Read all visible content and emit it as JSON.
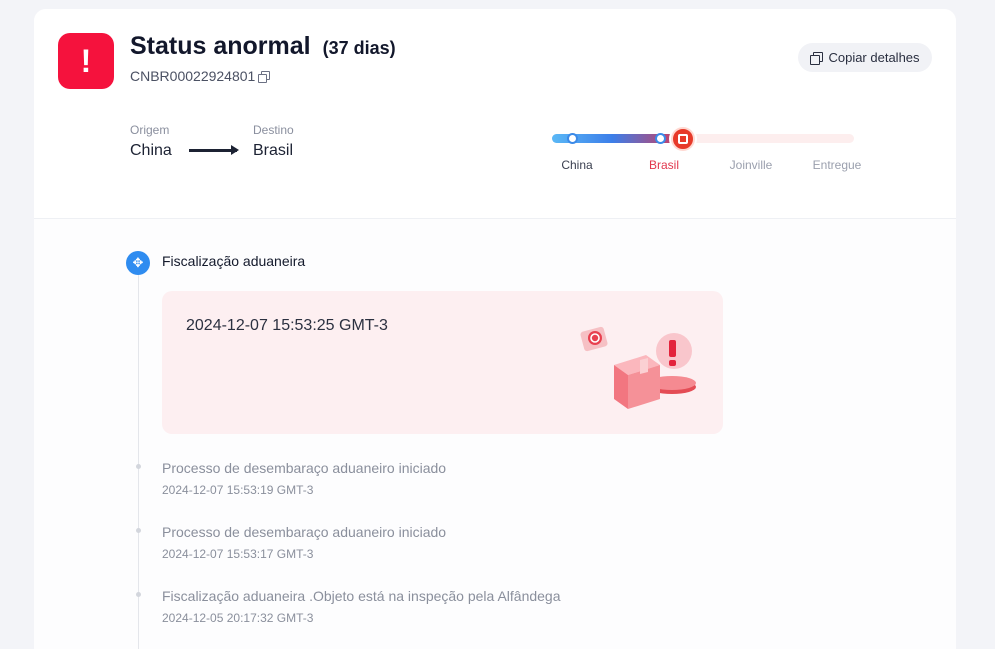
{
  "status": {
    "icon": "alert-icon",
    "icon_text": "!",
    "title": "Status anormal",
    "days": "(37 dias)",
    "tracking_number": "CNBR00022924801",
    "copy_button_label": "Copiar detalhes"
  },
  "route": {
    "origin_label": "Origem",
    "origin": "China",
    "destination_label": "Destino",
    "destination": "Brasil"
  },
  "progress": {
    "stages": [
      "China",
      "Brasil",
      "Joinville",
      "Entregue"
    ],
    "current_stage": "Brasil"
  },
  "timeline": {
    "current_event": {
      "icon": "customs-icon",
      "title": "Fiscalização aduaneira",
      "datetime": "2024-12-07 15:53:25 GMT-3"
    },
    "events": [
      {
        "description": "Processo de desembaraço aduaneiro iniciado",
        "datetime": "2024-12-07 15:53:19 GMT-3"
      },
      {
        "description": "Processo de desembaraço aduaneiro iniciado",
        "datetime": "2024-12-07 15:53:17 GMT-3"
      },
      {
        "description": "Fiscalização aduaneira .Objeto está na inspeção pela Alfândega",
        "datetime": "2024-12-05 20:17:32 GMT-3"
      }
    ]
  },
  "colors": {
    "alert": "#f5123d",
    "accent_blue": "#2f8cf0",
    "brasil_stage": "#e2374d"
  }
}
